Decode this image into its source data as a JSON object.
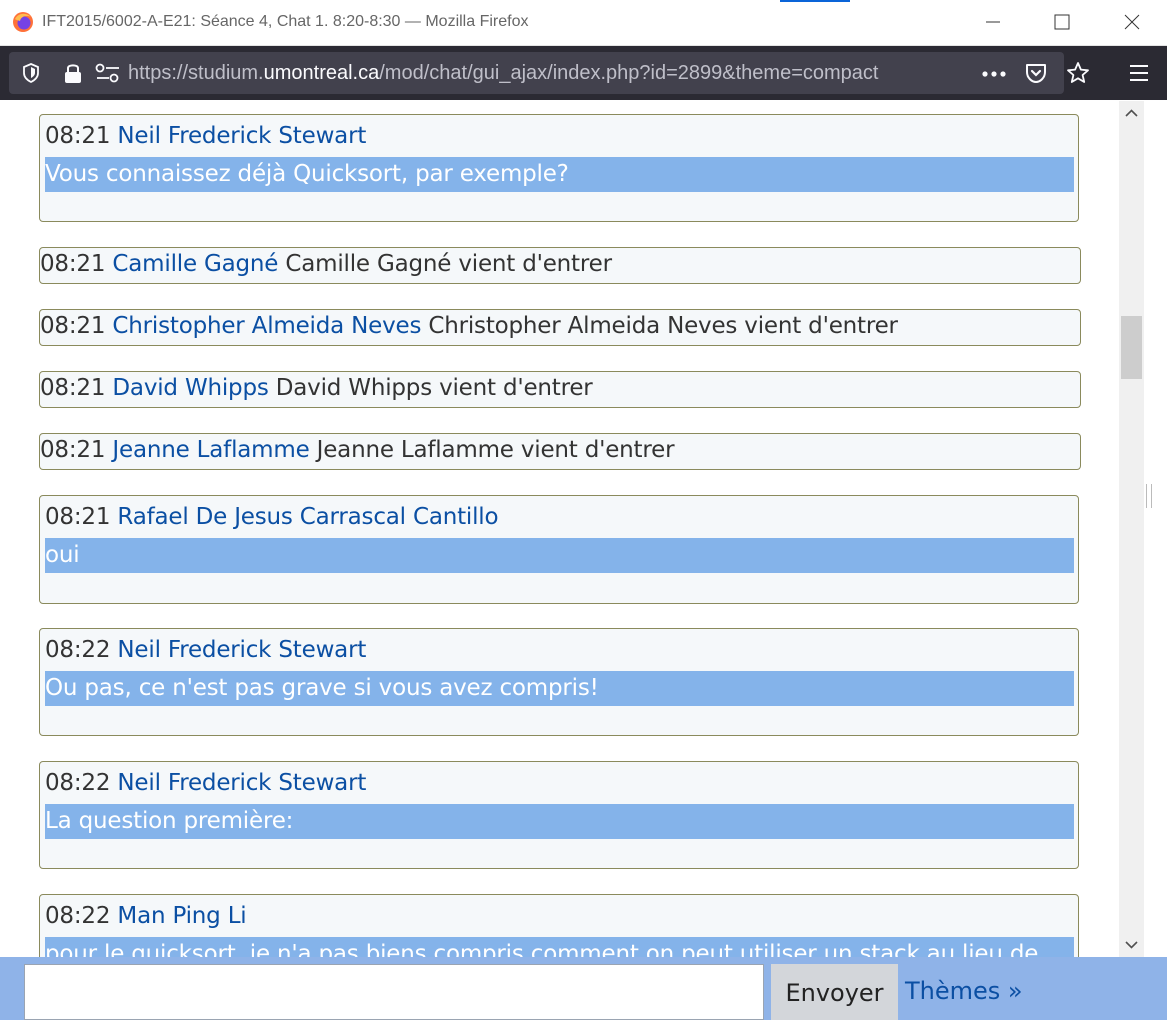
{
  "window": {
    "title": "IFT2015/6002-A-E21: Séance 4, Chat 1. 8:20-8:30 — Mozilla Firefox"
  },
  "navbar": {
    "url_prefix": "https://studium.",
    "url_host": "umontreal.ca",
    "url_path": "/mod/chat/gui_ajax/index.php?id=2899&theme=compact"
  },
  "messages": [
    {
      "time": "08:21",
      "user": "Neil Frederick Stewart",
      "text": "Vous connaissez déjà Quicksort, par exemple?"
    },
    {
      "time": "08:21",
      "user": "Camille Gagné",
      "text": "Camille Gagné vient d'entrer"
    },
    {
      "time": "08:21",
      "user": "Christopher Almeida Neves",
      "text": "Christopher Almeida Neves vient d'entrer"
    },
    {
      "time": "08:21",
      "user": "David Whipps",
      "text": "David Whipps vient d'entrer"
    },
    {
      "time": "08:21",
      "user": "Jeanne Laflamme",
      "text": "Jeanne Laflamme vient d'entrer"
    },
    {
      "time": "08:21",
      "user": "Rafael De Jesus Carrascal Cantillo",
      "text": "oui"
    },
    {
      "time": "08:22",
      "user": "Neil Frederick Stewart",
      "text": "Ou pas, ce n'est pas grave si vous avez compris!"
    },
    {
      "time": "08:22",
      "user": "Neil Frederick Stewart",
      "text": "La question première:"
    },
    {
      "time": "08:22",
      "user": "Man Ping Li",
      "text": "pour le quicksort, je n'a pas biens compris comment on peut utiliser un stack au lieu de"
    }
  ],
  "input": {
    "value": "",
    "send_label": "Envoyer",
    "themes_label": "Thèmes »"
  },
  "scroll": {
    "position_fraction": 0.27
  }
}
